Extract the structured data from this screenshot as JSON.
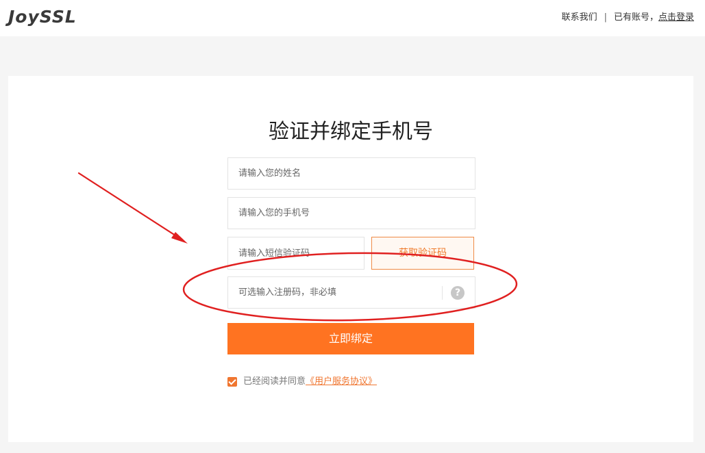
{
  "header": {
    "logo_text": "JoySSL",
    "contact_label": "联系我们",
    "separator": "|",
    "have_account_text": "已有账号，",
    "login_link": "点击登录"
  },
  "form": {
    "title": "验证并绑定手机号",
    "name_placeholder": "请输入您的姓名",
    "phone_placeholder": "请输入您的手机号",
    "sms_code_placeholder": "请输入短信验证码",
    "get_code_label": "获取验证码",
    "register_code_placeholder": "可选输入注册码，非必填",
    "help_symbol": "?",
    "submit_label": "立即绑定",
    "agree_text": "已经阅读并同意",
    "agreement_link": "《用户服务协议》",
    "agree_checked": true
  },
  "colors": {
    "accent": "#ff7321",
    "annotation": "#e02020"
  }
}
